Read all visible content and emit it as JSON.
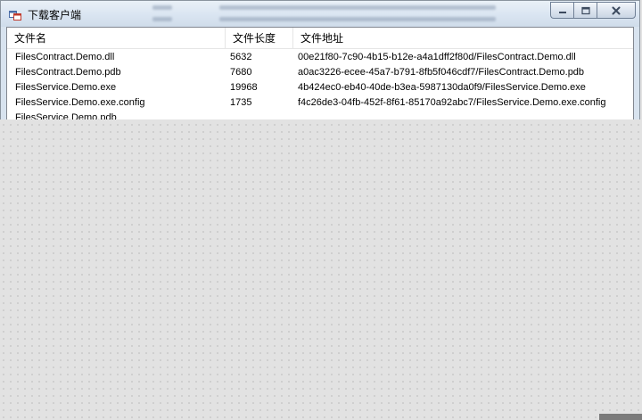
{
  "window": {
    "title": "下载客户端",
    "icon": "app-window-icon",
    "caption_buttons": [
      "minimize-icon",
      "maximize-icon",
      "close-icon"
    ]
  },
  "list": {
    "columns": [
      "文件名",
      "文件长度",
      "文件地址"
    ],
    "rows": [
      {
        "name": "FilesContract.Demo.dll",
        "length": "5632",
        "path": "00e21f80-7c90-4b15-b12e-a4a1dff2f80d/FilesContract.Demo.dll"
      },
      {
        "name": "FilesContract.Demo.pdb",
        "length": "7680",
        "path": "a0ac3226-ecee-45a7-b791-8fb5f046cdf7/FilesContract.Demo.pdb"
      },
      {
        "name": "FilesService.Demo.exe",
        "length": "19968",
        "path": "4b424ec0-eb40-40de-b3ea-5987130da0f9/FilesService.Demo.exe"
      },
      {
        "name": "FilesService.Demo.exe.config",
        "length": "1735",
        "path": "f4c26de3-04fb-452f-8f61-85170a92abc7/FilesService.Demo.exe.config"
      },
      {
        "name": "FilesService.Demo.pdb",
        "length": "",
        "path": ""
      }
    ]
  }
}
